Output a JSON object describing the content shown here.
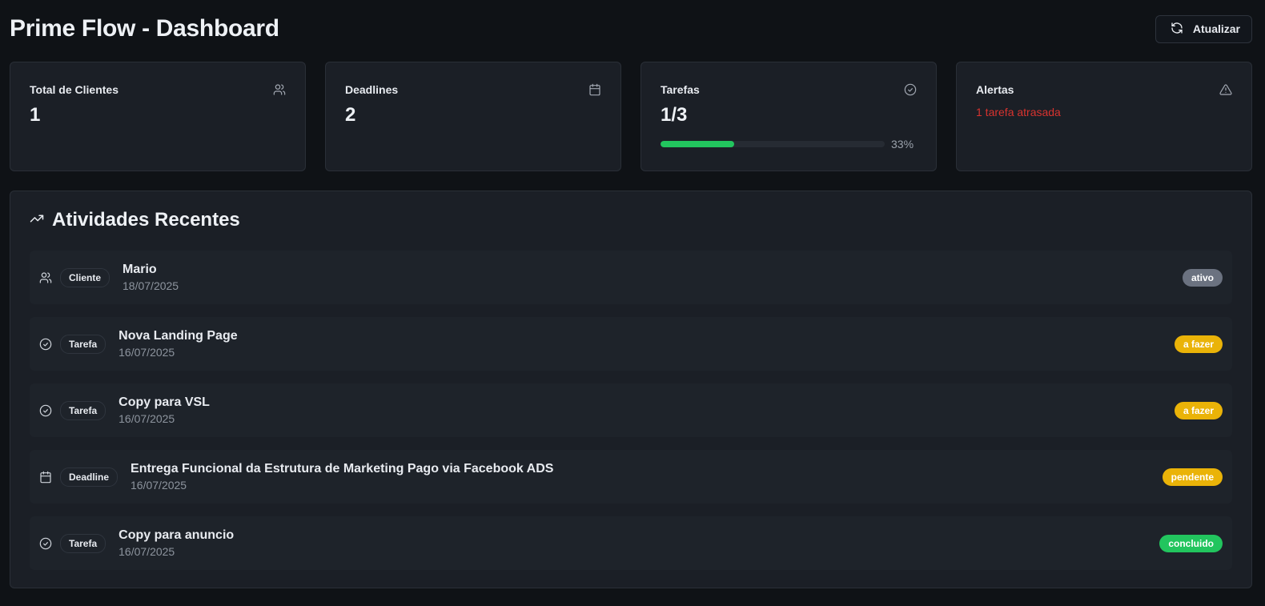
{
  "header": {
    "title": "Prime Flow - Dashboard",
    "refresh_label": "Atualizar"
  },
  "stats": {
    "clients": {
      "title": "Total de Clientes",
      "value": "1",
      "icon": "users-icon"
    },
    "deadlines": {
      "title": "Deadlines",
      "value": "2",
      "icon": "calendar-icon"
    },
    "tasks": {
      "title": "Tarefas",
      "value": "1/3",
      "progress_percent": 33,
      "progress_label": "33%",
      "icon": "check-circle-icon"
    },
    "alerts": {
      "title": "Alertas",
      "message": "1 tarefa atrasada",
      "icon": "warning-icon"
    }
  },
  "activities": {
    "title": "Atividades Recentes",
    "items": [
      {
        "icon": "users-icon",
        "type": "Cliente",
        "name": "Mario",
        "date": "18/07/2025",
        "status": "ativo",
        "status_color": "#6b7280",
        "status_text_color": "#ffffff"
      },
      {
        "icon": "check-circle-icon",
        "type": "Tarefa",
        "name": "Nova Landing Page",
        "date": "16/07/2025",
        "status": "a fazer",
        "status_color": "#eab308",
        "status_text_color": "#ffffff"
      },
      {
        "icon": "check-circle-icon",
        "type": "Tarefa",
        "name": "Copy para VSL",
        "date": "16/07/2025",
        "status": "a fazer",
        "status_color": "#eab308",
        "status_text_color": "#ffffff"
      },
      {
        "icon": "calendar-icon",
        "type": "Deadline",
        "name": "Entrega Funcional da Estrutura de Marketing Pago via Facebook ADS",
        "date": "16/07/2025",
        "status": "pendente",
        "status_color": "#eab308",
        "status_text_color": "#ffffff"
      },
      {
        "icon": "check-circle-icon",
        "type": "Tarefa",
        "name": "Copy para anuncio",
        "date": "16/07/2025",
        "status": "concluido",
        "status_color": "#22c55e",
        "status_text_color": "#ffffff"
      }
    ]
  }
}
